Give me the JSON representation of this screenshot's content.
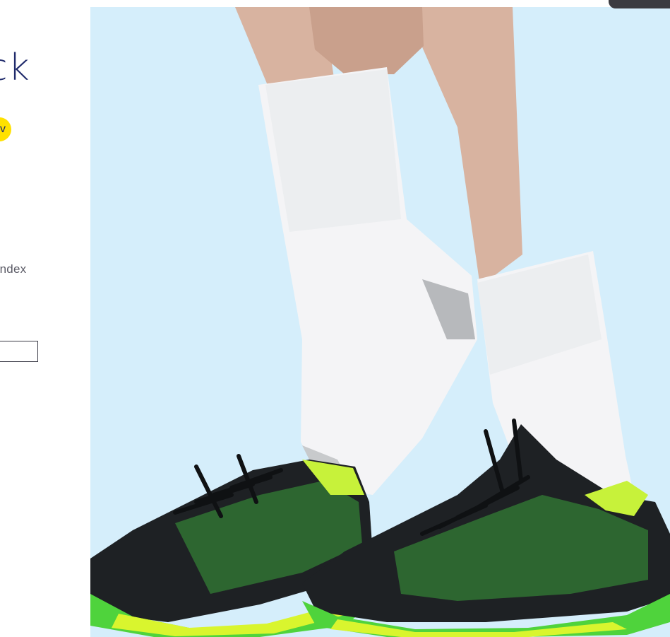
{
  "product": {
    "title": "ck",
    "badge": "v",
    "material": "andex"
  },
  "colors": {
    "title": "#1f2a6b",
    "badge_bg": "#ffe100",
    "hero_bg": "#d5eefb",
    "sock": "#f4f4f6",
    "sock_grey": "#b7b9bc",
    "shoe_black": "#1e2124",
    "shoe_green": "#4fd33c",
    "shoe_lime": "#c7f23a"
  },
  "icons": {
    "top_tab": "tab-handle"
  }
}
